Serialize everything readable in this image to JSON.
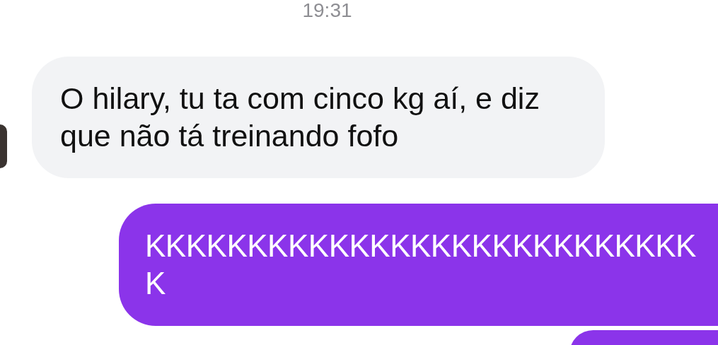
{
  "timestamp": "19:31",
  "messages": [
    {
      "kind": "received",
      "text": "O hilary, tu ta com cinco kg aí, e diz que não tá treinando fofo"
    },
    {
      "kind": "sent",
      "text": "KKKKKKKKKKKKKKKKKKKKKKKKKKKK"
    },
    {
      "kind": "sent"
    }
  ]
}
